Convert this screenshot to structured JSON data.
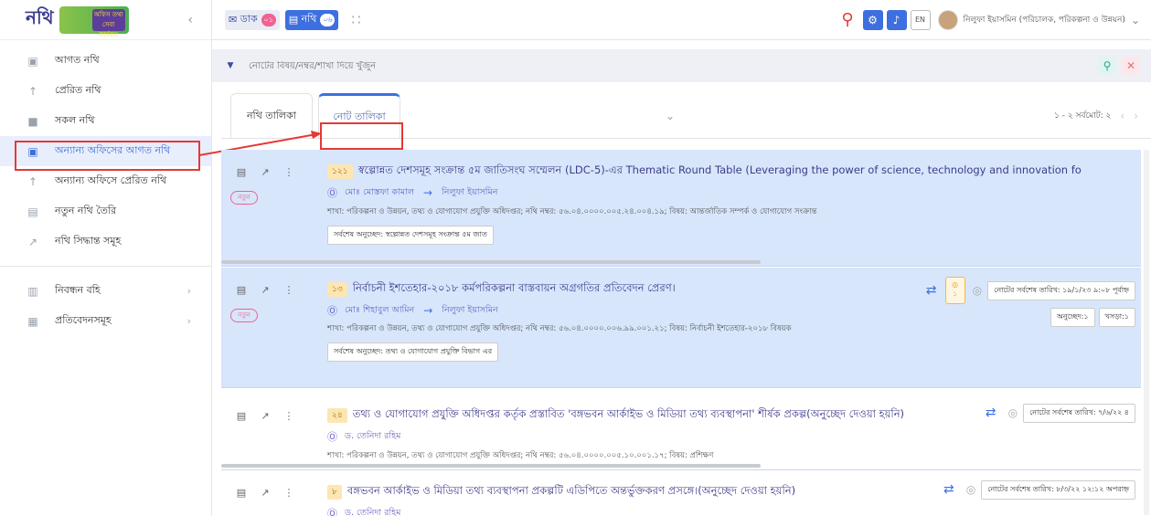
{
  "app": {
    "logo_text": "নথি",
    "logo_sub": "অফিস তথ্য সেবা কার্যক্রম"
  },
  "sidebar": {
    "items": [
      {
        "label": "আগত নথি",
        "icon": "inbox-icon"
      },
      {
        "label": "প্রেরিত নথি",
        "icon": "upload-icon"
      },
      {
        "label": "সকল নথি",
        "icon": "box-icon"
      },
      {
        "label": "অন্যান্য অফিসের আগত নথি",
        "icon": "inbox-icon"
      },
      {
        "label": "অন্যান্য অফিসে প্রেরিত নথি",
        "icon": "upload-icon"
      },
      {
        "label": "নতুন নথি তৈরি",
        "icon": "new-file-icon"
      },
      {
        "label": "নথি সিদ্ধান্ত সমূহ",
        "icon": "pin-icon"
      }
    ],
    "items2": [
      {
        "label": "নিবন্ধন বহি",
        "icon": "book-icon"
      },
      {
        "label": "প্রতিবেদনসমূহ",
        "icon": "report-icon"
      }
    ]
  },
  "topbar": {
    "dak_label": "ডাক",
    "dak_count": "০১",
    "nothi_label": "নথি",
    "nothi_count": "০৬",
    "lang": "EN",
    "user_name": "নিলুফা ইয়াসমিন (পরিচালক, পরিকল্পনা ও উন্নয়ন)"
  },
  "search": {
    "placeholder": "নোটের বিষয়/নম্বর/শাখা দিয়ে খুঁজুন"
  },
  "tabs": {
    "tab1": "নথি তালিকা",
    "tab2": "নোট তালিকা",
    "pager": "১ - ২ সর্বমোট: ২"
  },
  "cards": [
    {
      "num": "১২১",
      "title": "স্বল্পোন্নত দেশসমূহ সংক্রান্ত ৫ম জাতিসংঘ সম্মেলন (LDC-5)-এর Thematic Round Table (Leveraging the power of science, technology and innovation fo",
      "from": "মোঃ মোস্তফা কামাল",
      "to": "নিলুফা ইয়াসমিন",
      "meta": "শাখা: পরিকল্পনা ও উন্নয়ন, তথ্য ও যোগাযোগ প্রযুক্তি অধিদপ্তর; নথি নম্বর: ৫৬.০৪.০০০০.০০৫.২৪.০০৪.১৯; বিষয়: আন্তর্জাতিক সম্পর্ক ও যোগাযোগ সংক্রান্ত",
      "last": "সর্বশেষ অনুচ্ছেদ: স্বল্পোন্নত দেশসমূহ সংক্রান্ত ৫ম জাত",
      "new_label": "নতুন"
    },
    {
      "num": "১৩",
      "title": "নির্বাচনী ইশতেহার-২০১৮ কর্মপরিকল্পনা বাস্তবায়ন অগ্রগতির প্রতিবেদন প্রেরণ।",
      "from": "মোঃ শিহাবুল আমিন",
      "to": "নিলুফা ইয়াসমিন",
      "meta": "শাখা: পরিকল্পনা ও উন্নয়ন, তথ্য ও যোগাযোগ প্রযুক্তি অধিদপ্তর; নথি নম্বর: ৫৬.০৪.০০০০.০০৬.৯৯.০০১.২১; বিষয়: নির্বাচনী ইশতেহার-২০১৮ বিষয়ক",
      "last": "সর্বশেষ অনুচ্ছেদ: তথ্য ও যোগাযোগ প্রযুক্তি বিভাগ এর",
      "new_label": "নতুন",
      "date": "নোটের সর্বশেষ তারিখ: ১৯/১/২৩ ৯:০৮ পূর্বাহ্ন",
      "count1": "অনুচ্ছেদ:১",
      "count2": "খসড়া:১",
      "box_count": "১"
    },
    {
      "num": "২৪",
      "title": "তথ্য ও যোগাযোগ প্রযুক্তি অধিদপ্তর কর্তৃক প্রস্তাবিত 'বঙ্গভবন আর্কাইভ ও মিডিয়া তথ্য ব্যবস্থাপনা' শীর্ষক প্রকল্প(অনুচ্ছেদ দেওয়া হয়নি)",
      "from": "ড. তেনিদা রহিম",
      "meta": "শাখা: পরিকল্পনা ও উন্নয়ন, তথ্য ও যোগাযোগ প্রযুক্তি অধিদপ্তর; নথি নম্বর: ৫৬.০৪.০০০০.০০৫.১০.০০১.১৭; বিষয়: প্রশিক্ষণ",
      "date": "নোটের সর্বশেষ তারিখ: ৭/৬/২২ ৪"
    },
    {
      "num": "৮",
      "title": "বঙ্গভবন আর্কাইভ ও মিডিয়া তথ্য ব্যবস্থাপনা প্রকল্পটি এডিপিতে অন্তর্ভুক্তকরণ প্রসঙ্গে।(অনুচ্ছেদ দেওয়া হয়নি)",
      "from": "ড. তেনিদা রহিম",
      "date": "নোটের সর্বশেষ তারিখ: ৮/৩/২২ ১২:১২ অপরাহ্ন"
    }
  ]
}
